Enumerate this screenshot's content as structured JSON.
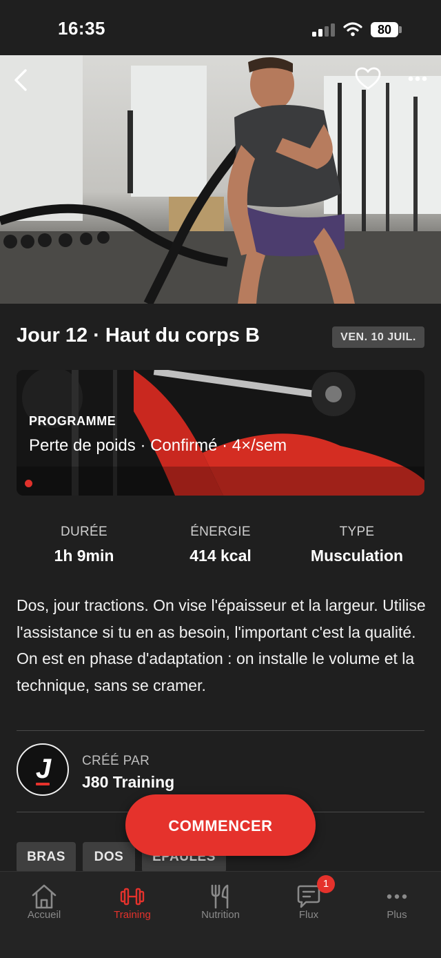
{
  "status_bar": {
    "time": "16:35",
    "battery": "80"
  },
  "workout": {
    "title": "Jour 12 · Haut du corps B",
    "date": "VEN. 10 JUIL."
  },
  "program": {
    "label": "PROGRAMME",
    "description": "Perte de poids · Confirmé · 4×/sem"
  },
  "stats": [
    {
      "label": "DURÉE",
      "value": "1h 9min"
    },
    {
      "label": "ÉNERGIE",
      "value": "414 kcal"
    },
    {
      "label": "TYPE",
      "value": "Musculation"
    }
  ],
  "description": "Dos, jour tractions. On vise l'épaisseur et la largeur. Utilise l'assistance si tu en as besoin, l'important c'est la qualité. On est en phase d'adaptation : on installe le volume et la technique, sans se cramer.",
  "creator": {
    "label": "CRÉÉ PAR",
    "name": "J80 Training",
    "logo_letter": "J"
  },
  "tags": [
    "BRAS",
    "DOS",
    "ÉPAULES"
  ],
  "start_button": "COMMENCER",
  "tab_bar": {
    "items": [
      {
        "label": "Accueil",
        "icon": "home-icon"
      },
      {
        "label": "Training",
        "icon": "dumbbell-icon"
      },
      {
        "label": "Nutrition",
        "icon": "fork-knife-icon"
      },
      {
        "label": "Flux",
        "icon": "chat-icon",
        "badge": "1"
      },
      {
        "label": "Plus",
        "icon": "more-icon"
      }
    ],
    "active": "Training"
  },
  "colors": {
    "accent": "#e5322c",
    "background": "#1f1f1f",
    "inactive": "#8a8a8a"
  }
}
